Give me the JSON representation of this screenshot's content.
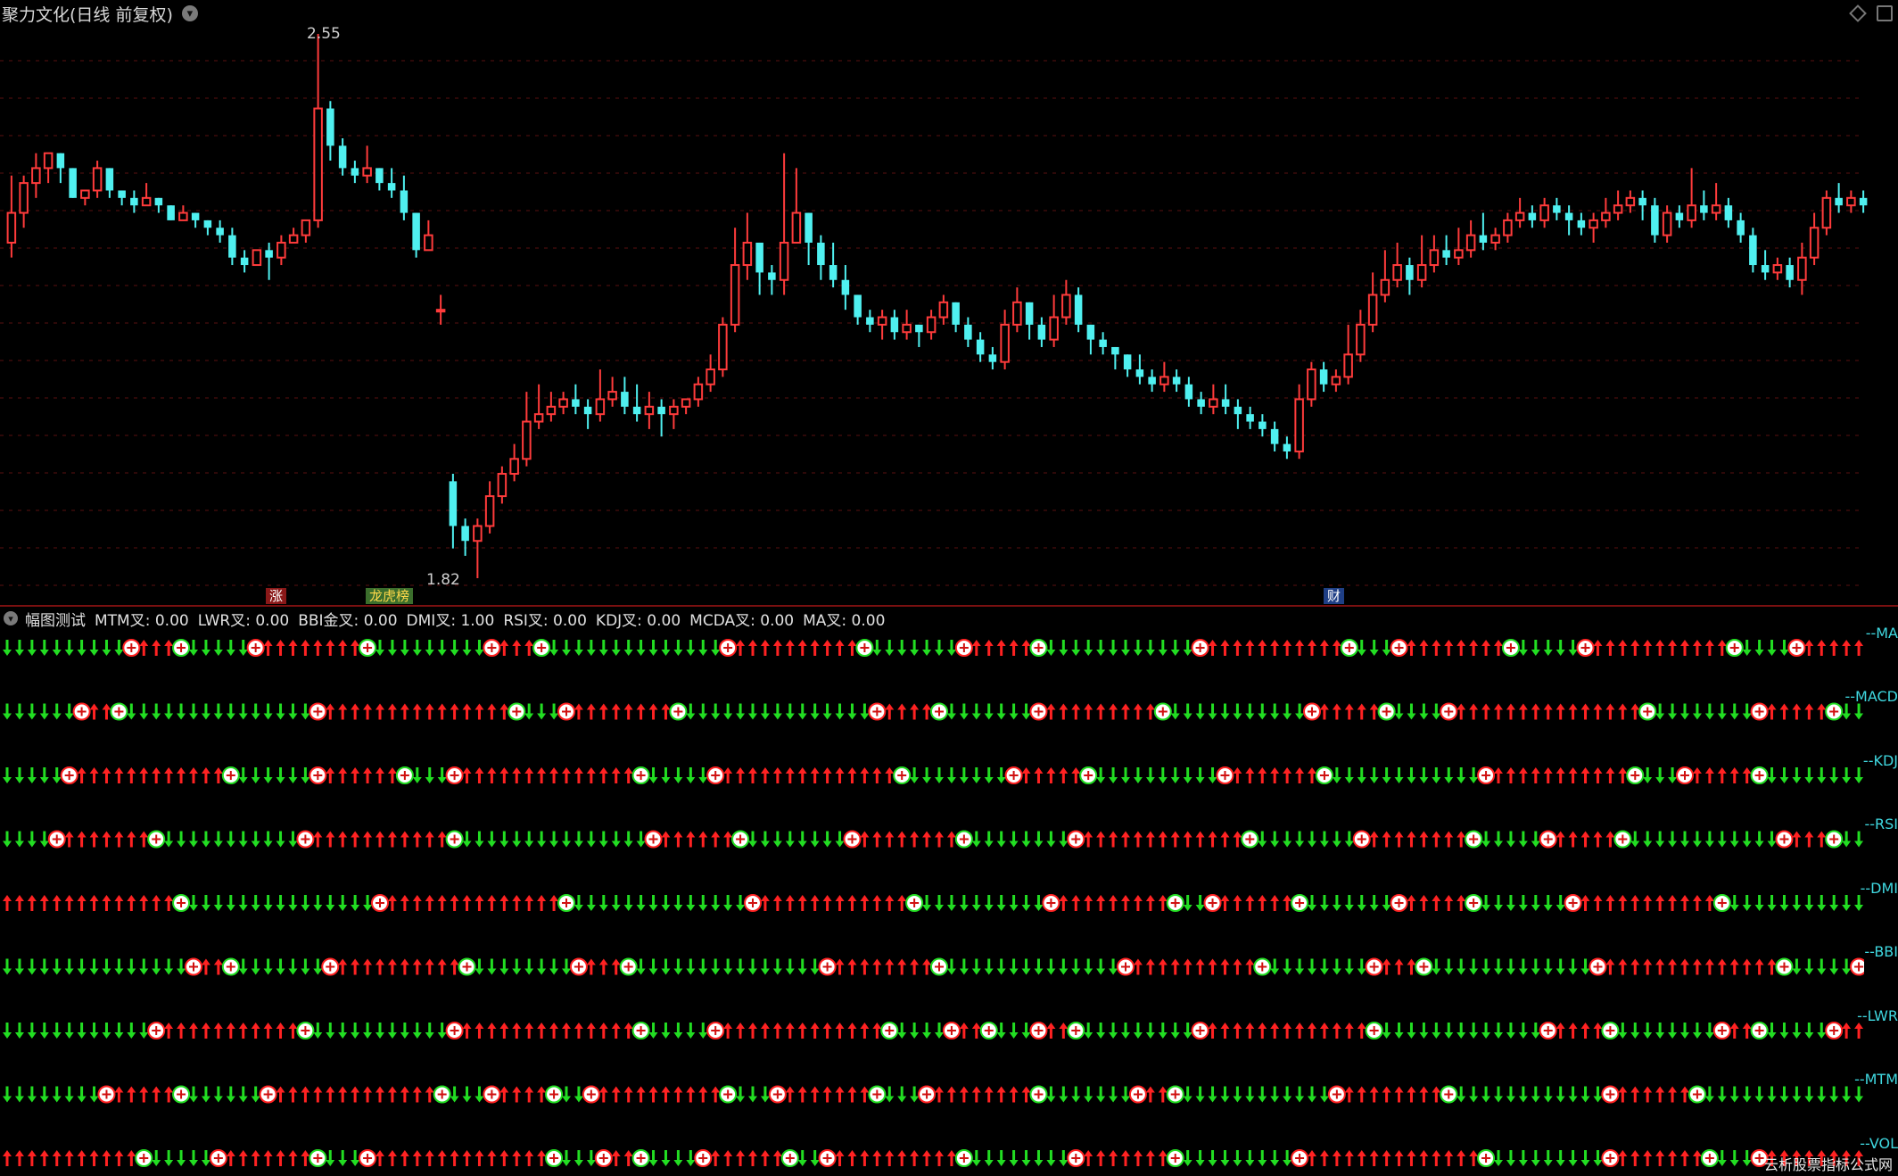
{
  "header": {
    "title": "聚力文化(日线 前复权)",
    "dropdown_icon": "chevron-down-icon"
  },
  "window_controls": [
    "diamond-icon",
    "restore-window-icon"
  ],
  "price_labels": {
    "high": "2.55",
    "low": "1.82"
  },
  "badges": {
    "zhang": "涨",
    "bang": "龙虎榜",
    "cai": "财"
  },
  "indicator_header": {
    "name": "幅图测试",
    "items": [
      "MTM叉: 0.00",
      "LWR叉: 0.00",
      "BBI金叉: 0.00",
      "DMI叉: 1.00",
      "RSI叉: 0.00",
      "KDJ叉: 0.00",
      "MCDA叉: 0.00",
      "MA叉: 0.00"
    ]
  },
  "signal_rows": [
    "--MA",
    "--MACD",
    "--KDJ",
    "--RSI",
    "--DMI",
    "--BBI",
    "--LWR",
    "--MTM",
    "--VOL"
  ],
  "watermark": "云析股票指标公式网",
  "colors": {
    "background": "#000000",
    "up": "#ff3b3b",
    "down": "#4ff0f0",
    "grid": "#5a1010",
    "arrow_up": "#ff2222",
    "arrow_down": "#22dd22",
    "row_label": "#3fd8e0"
  },
  "chart_data": {
    "type": "candlestick",
    "title": "聚力文化(日线 前复权)",
    "ylim": [
      1.82,
      2.55
    ],
    "annotations": [
      {
        "label": "2.55",
        "kind": "high"
      },
      {
        "label": "1.82",
        "kind": "low"
      }
    ],
    "candles": [
      [
        2.27,
        2.31,
        2.36,
        2.25
      ],
      [
        2.31,
        2.35,
        2.36,
        2.29
      ],
      [
        2.35,
        2.37,
        2.39,
        2.33
      ],
      [
        2.37,
        2.39,
        2.39,
        2.35
      ],
      [
        2.39,
        2.37,
        2.39,
        2.35
      ],
      [
        2.37,
        2.33,
        2.37,
        2.33
      ],
      [
        2.33,
        2.34,
        2.34,
        2.32
      ],
      [
        2.34,
        2.37,
        2.38,
        2.33
      ],
      [
        2.37,
        2.34,
        2.37,
        2.33
      ],
      [
        2.34,
        2.33,
        2.34,
        2.32
      ],
      [
        2.33,
        2.32,
        2.34,
        2.31
      ],
      [
        2.32,
        2.33,
        2.35,
        2.32
      ],
      [
        2.33,
        2.32,
        2.33,
        2.31
      ],
      [
        2.32,
        2.3,
        2.32,
        2.3
      ],
      [
        2.3,
        2.31,
        2.32,
        2.3
      ],
      [
        2.31,
        2.3,
        2.31,
        2.29
      ],
      [
        2.3,
        2.29,
        2.3,
        2.28
      ],
      [
        2.29,
        2.28,
        2.3,
        2.27
      ],
      [
        2.28,
        2.25,
        2.29,
        2.24
      ],
      [
        2.25,
        2.24,
        2.26,
        2.23
      ],
      [
        2.24,
        2.26,
        2.26,
        2.24
      ],
      [
        2.26,
        2.25,
        2.27,
        2.22
      ],
      [
        2.25,
        2.27,
        2.28,
        2.24
      ],
      [
        2.27,
        2.28,
        2.29,
        2.27
      ],
      [
        2.28,
        2.3,
        2.3,
        2.27
      ],
      [
        2.3,
        2.45,
        2.55,
        2.29
      ],
      [
        2.45,
        2.4,
        2.46,
        2.38
      ],
      [
        2.4,
        2.37,
        2.41,
        2.36
      ],
      [
        2.37,
        2.36,
        2.38,
        2.35
      ],
      [
        2.36,
        2.37,
        2.4,
        2.35
      ],
      [
        2.37,
        2.35,
        2.37,
        2.34
      ],
      [
        2.35,
        2.34,
        2.37,
        2.33
      ],
      [
        2.34,
        2.31,
        2.36,
        2.3
      ],
      [
        2.31,
        2.26,
        2.31,
        2.25
      ],
      [
        2.26,
        2.28,
        2.3,
        2.26
      ],
      [
        2.18,
        2.18,
        2.2,
        2.16
      ],
      [
        1.95,
        1.89,
        1.96,
        1.86
      ],
      [
        1.89,
        1.87,
        1.9,
        1.85
      ],
      [
        1.87,
        1.89,
        1.9,
        1.82
      ],
      [
        1.89,
        1.93,
        1.95,
        1.88
      ],
      [
        1.93,
        1.96,
        1.97,
        1.92
      ],
      [
        1.96,
        1.98,
        2.0,
        1.95
      ],
      [
        1.98,
        2.03,
        2.07,
        1.97
      ],
      [
        2.03,
        2.04,
        2.08,
        2.02
      ],
      [
        2.04,
        2.05,
        2.07,
        2.03
      ],
      [
        2.05,
        2.06,
        2.07,
        2.04
      ],
      [
        2.06,
        2.05,
        2.08,
        2.04
      ],
      [
        2.05,
        2.04,
        2.06,
        2.02
      ],
      [
        2.04,
        2.06,
        2.1,
        2.03
      ],
      [
        2.06,
        2.07,
        2.09,
        2.05
      ],
      [
        2.07,
        2.05,
        2.09,
        2.04
      ],
      [
        2.05,
        2.04,
        2.08,
        2.03
      ],
      [
        2.04,
        2.05,
        2.07,
        2.02
      ],
      [
        2.05,
        2.04,
        2.06,
        2.01
      ],
      [
        2.04,
        2.05,
        2.06,
        2.02
      ],
      [
        2.05,
        2.06,
        2.06,
        2.04
      ],
      [
        2.06,
        2.08,
        2.09,
        2.05
      ],
      [
        2.08,
        2.1,
        2.12,
        2.07
      ],
      [
        2.1,
        2.16,
        2.17,
        2.09
      ],
      [
        2.16,
        2.24,
        2.29,
        2.15
      ],
      [
        2.24,
        2.27,
        2.31,
        2.22
      ],
      [
        2.27,
        2.23,
        2.27,
        2.2
      ],
      [
        2.23,
        2.22,
        2.24,
        2.2
      ],
      [
        2.22,
        2.27,
        2.39,
        2.2
      ],
      [
        2.27,
        2.31,
        2.37,
        2.27
      ],
      [
        2.31,
        2.27,
        2.31,
        2.24
      ],
      [
        2.27,
        2.24,
        2.28,
        2.22
      ],
      [
        2.24,
        2.22,
        2.27,
        2.21
      ],
      [
        2.22,
        2.2,
        2.24,
        2.18
      ],
      [
        2.2,
        2.17,
        2.2,
        2.16
      ],
      [
        2.17,
        2.16,
        2.18,
        2.15
      ],
      [
        2.16,
        2.17,
        2.18,
        2.14
      ],
      [
        2.17,
        2.15,
        2.18,
        2.14
      ],
      [
        2.15,
        2.16,
        2.18,
        2.14
      ],
      [
        2.16,
        2.15,
        2.16,
        2.13
      ],
      [
        2.15,
        2.17,
        2.18,
        2.14
      ],
      [
        2.17,
        2.19,
        2.2,
        2.16
      ],
      [
        2.19,
        2.16,
        2.19,
        2.15
      ],
      [
        2.16,
        2.14,
        2.17,
        2.13
      ],
      [
        2.14,
        2.12,
        2.15,
        2.11
      ],
      [
        2.12,
        2.11,
        2.13,
        2.1
      ],
      [
        2.11,
        2.16,
        2.18,
        2.1
      ],
      [
        2.16,
        2.19,
        2.21,
        2.15
      ],
      [
        2.19,
        2.16,
        2.19,
        2.14
      ],
      [
        2.16,
        2.14,
        2.17,
        2.13
      ],
      [
        2.14,
        2.17,
        2.2,
        2.13
      ],
      [
        2.17,
        2.2,
        2.22,
        2.16
      ],
      [
        2.2,
        2.16,
        2.21,
        2.15
      ],
      [
        2.16,
        2.14,
        2.16,
        2.12
      ],
      [
        2.14,
        2.13,
        2.15,
        2.12
      ],
      [
        2.13,
        2.12,
        2.13,
        2.1
      ],
      [
        2.12,
        2.1,
        2.12,
        2.09
      ],
      [
        2.1,
        2.09,
        2.12,
        2.08
      ],
      [
        2.09,
        2.08,
        2.1,
        2.07
      ],
      [
        2.08,
        2.09,
        2.11,
        2.07
      ],
      [
        2.09,
        2.08,
        2.1,
        2.07
      ],
      [
        2.08,
        2.06,
        2.09,
        2.05
      ],
      [
        2.06,
        2.05,
        2.07,
        2.04
      ],
      [
        2.05,
        2.06,
        2.08,
        2.04
      ],
      [
        2.06,
        2.05,
        2.08,
        2.04
      ],
      [
        2.05,
        2.04,
        2.06,
        2.02
      ],
      [
        2.04,
        2.03,
        2.05,
        2.02
      ],
      [
        2.03,
        2.02,
        2.04,
        2.01
      ],
      [
        2.02,
        2.0,
        2.03,
        1.99
      ],
      [
        2.0,
        1.99,
        2.01,
        1.98
      ],
      [
        1.99,
        2.06,
        2.08,
        1.98
      ],
      [
        2.06,
        2.1,
        2.11,
        2.05
      ],
      [
        2.1,
        2.08,
        2.11,
        2.07
      ],
      [
        2.08,
        2.09,
        2.1,
        2.07
      ],
      [
        2.09,
        2.12,
        2.16,
        2.08
      ],
      [
        2.12,
        2.16,
        2.18,
        2.11
      ],
      [
        2.16,
        2.2,
        2.23,
        2.15
      ],
      [
        2.2,
        2.22,
        2.26,
        2.19
      ],
      [
        2.22,
        2.24,
        2.27,
        2.21
      ],
      [
        2.24,
        2.22,
        2.25,
        2.2
      ],
      [
        2.22,
        2.24,
        2.28,
        2.21
      ],
      [
        2.24,
        2.26,
        2.28,
        2.23
      ],
      [
        2.26,
        2.25,
        2.28,
        2.24
      ],
      [
        2.25,
        2.26,
        2.29,
        2.24
      ],
      [
        2.26,
        2.28,
        2.3,
        2.25
      ],
      [
        2.28,
        2.27,
        2.31,
        2.26
      ],
      [
        2.27,
        2.28,
        2.29,
        2.26
      ],
      [
        2.28,
        2.3,
        2.31,
        2.27
      ],
      [
        2.3,
        2.31,
        2.33,
        2.29
      ],
      [
        2.31,
        2.3,
        2.32,
        2.29
      ],
      [
        2.3,
        2.32,
        2.33,
        2.29
      ],
      [
        2.32,
        2.31,
        2.33,
        2.3
      ],
      [
        2.31,
        2.3,
        2.32,
        2.28
      ],
      [
        2.3,
        2.29,
        2.31,
        2.28
      ],
      [
        2.29,
        2.3,
        2.31,
        2.27
      ],
      [
        2.3,
        2.31,
        2.33,
        2.29
      ],
      [
        2.31,
        2.32,
        2.34,
        2.3
      ],
      [
        2.32,
        2.33,
        2.34,
        2.31
      ],
      [
        2.33,
        2.32,
        2.34,
        2.3
      ],
      [
        2.32,
        2.28,
        2.33,
        2.27
      ],
      [
        2.28,
        2.31,
        2.32,
        2.27
      ],
      [
        2.31,
        2.3,
        2.32,
        2.29
      ],
      [
        2.3,
        2.32,
        2.37,
        2.29
      ],
      [
        2.32,
        2.31,
        2.34,
        2.3
      ],
      [
        2.31,
        2.32,
        2.35,
        2.3
      ],
      [
        2.32,
        2.3,
        2.33,
        2.29
      ],
      [
        2.3,
        2.28,
        2.31,
        2.27
      ],
      [
        2.28,
        2.24,
        2.29,
        2.23
      ],
      [
        2.24,
        2.23,
        2.26,
        2.22
      ],
      [
        2.23,
        2.24,
        2.25,
        2.22
      ],
      [
        2.24,
        2.22,
        2.25,
        2.21
      ],
      [
        2.22,
        2.25,
        2.27,
        2.2
      ],
      [
        2.25,
        2.29,
        2.31,
        2.24
      ],
      [
        2.29,
        2.33,
        2.34,
        2.28
      ],
      [
        2.33,
        2.32,
        2.35,
        2.31
      ],
      [
        2.32,
        2.33,
        2.34,
        2.31
      ],
      [
        2.33,
        2.32,
        2.34,
        2.31
      ]
    ]
  }
}
